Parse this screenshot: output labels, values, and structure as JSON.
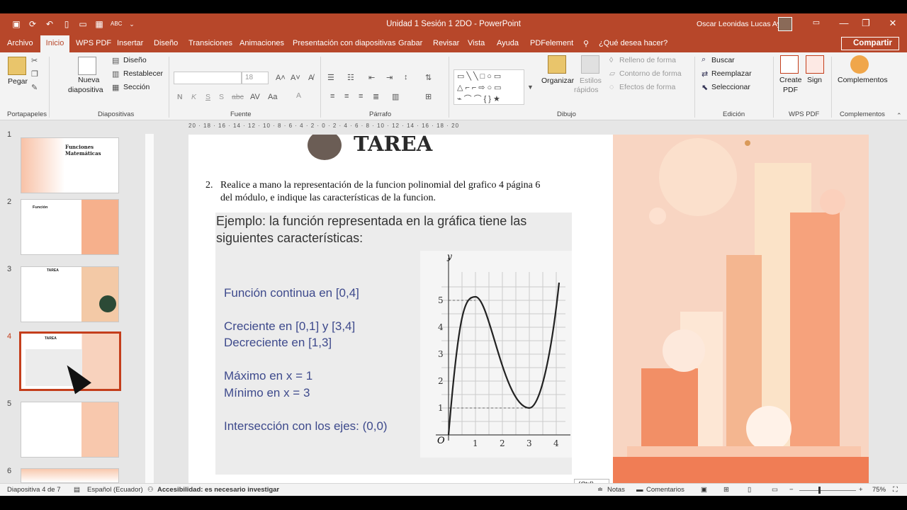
{
  "window": {
    "doc_title": "Unidad 1 Sesión 1 2DO  -  PowerPoint",
    "user_name": "Oscar Leonidas Lucas Ayala",
    "quick_access": [
      "save-icon",
      "autosave-icon",
      "undo-icon",
      "redo-icon",
      "new-icon",
      "open-icon",
      "present-icon",
      "spelling-icon",
      "customize-icon"
    ],
    "controls": {
      "minimize": "—",
      "restore": "❐",
      "close": "✕",
      "ribbon_options": "▭"
    }
  },
  "tabs": [
    "Archivo",
    "Inicio",
    "WPS PDF",
    "Insertar",
    "Diseño",
    "Transiciones",
    "Animaciones",
    "Presentación con diapositivas",
    "Grabar",
    "Revisar",
    "Vista",
    "Ayuda",
    "PDFelement"
  ],
  "tell_me": "¿Qué desea hacer?",
  "share_label": "Compartir",
  "ribbon": {
    "portapapeles": {
      "paste": "Pegar",
      "label": "Portapapeles"
    },
    "diapositivas": {
      "new_slide_1": "Nueva",
      "new_slide_2": "diapositiva",
      "layout": "Diseño",
      "reset": "Restablecer",
      "section": "Sección",
      "label": "Diapositivas"
    },
    "fuente": {
      "font_size": "18",
      "bold": "N",
      "italic": "K",
      "underline": "S",
      "strike": "S",
      "shadow": "abc",
      "font_color": "A",
      "label": "Fuente"
    },
    "parrafo": {
      "label": "Párrafo"
    },
    "dibujo": {
      "arrange": "Organizar",
      "quick_styles_1": "Estilos",
      "quick_styles_2": "rápidos",
      "fill": "Relleno de forma",
      "outline": "Contorno de forma",
      "effects": "Efectos de forma",
      "label": "Dibujo"
    },
    "edicion": {
      "find": "Buscar",
      "replace": "Reemplazar",
      "select": "Seleccionar",
      "label": "Edición"
    },
    "wps": {
      "create_1": "Create",
      "create_2": "PDF",
      "sign": "Sign",
      "label": "WPS PDF"
    },
    "complementos": {
      "addins": "Complementos",
      "label": "Complementos"
    }
  },
  "slides_panel": {
    "numbers": [
      "1",
      "2",
      "3",
      "4",
      "5",
      "6"
    ],
    "thumb1_title": "Funciones Matemáticas",
    "thumb2_title": "Función",
    "thumb3_title": "TAREA",
    "thumb4_title": "TAREA",
    "active": 4
  },
  "slide": {
    "title": "TAREA",
    "task_number": "2.",
    "task_text": "Realice a mano la representación de la funcion polinomial del grafico 4 página 6 del módulo,  e indique las características de la funcion.",
    "example_heading": "Ejemplo: la función representada  en la gráfica tiene las siguientes características:",
    "properties": [
      "Función continua en [0,4]",
      "Creciente en [0,1] y [3,4]",
      "Decreciente en [1,3]",
      "Máximo en x = 1",
      "Mínimo en x = 3",
      "Intersección con los ejes: (0,0)"
    ],
    "graph": {
      "y_label": "y",
      "origin": "O",
      "x_ticks": [
        "1",
        "2",
        "3",
        "4"
      ],
      "y_ticks": [
        "1",
        "2",
        "3",
        "4",
        "5"
      ]
    }
  },
  "paste_options": "(Ctrl)",
  "ruler_text": "20 · 18 · 16 · 14 · 12 · 10 · 8 · 6 · 4 · 2 · 0 · 2 · 4 · 6 · 8 · 10 · 12 · 14 · 16 · 18 · 20",
  "status": {
    "slide_info": "Diapositiva 4 de 7",
    "language": "Español (Ecuador)",
    "accessibility": "Accesibilidad: es necesario investigar",
    "notes": "Notas",
    "comments": "Comentarios",
    "zoom": "75%"
  }
}
